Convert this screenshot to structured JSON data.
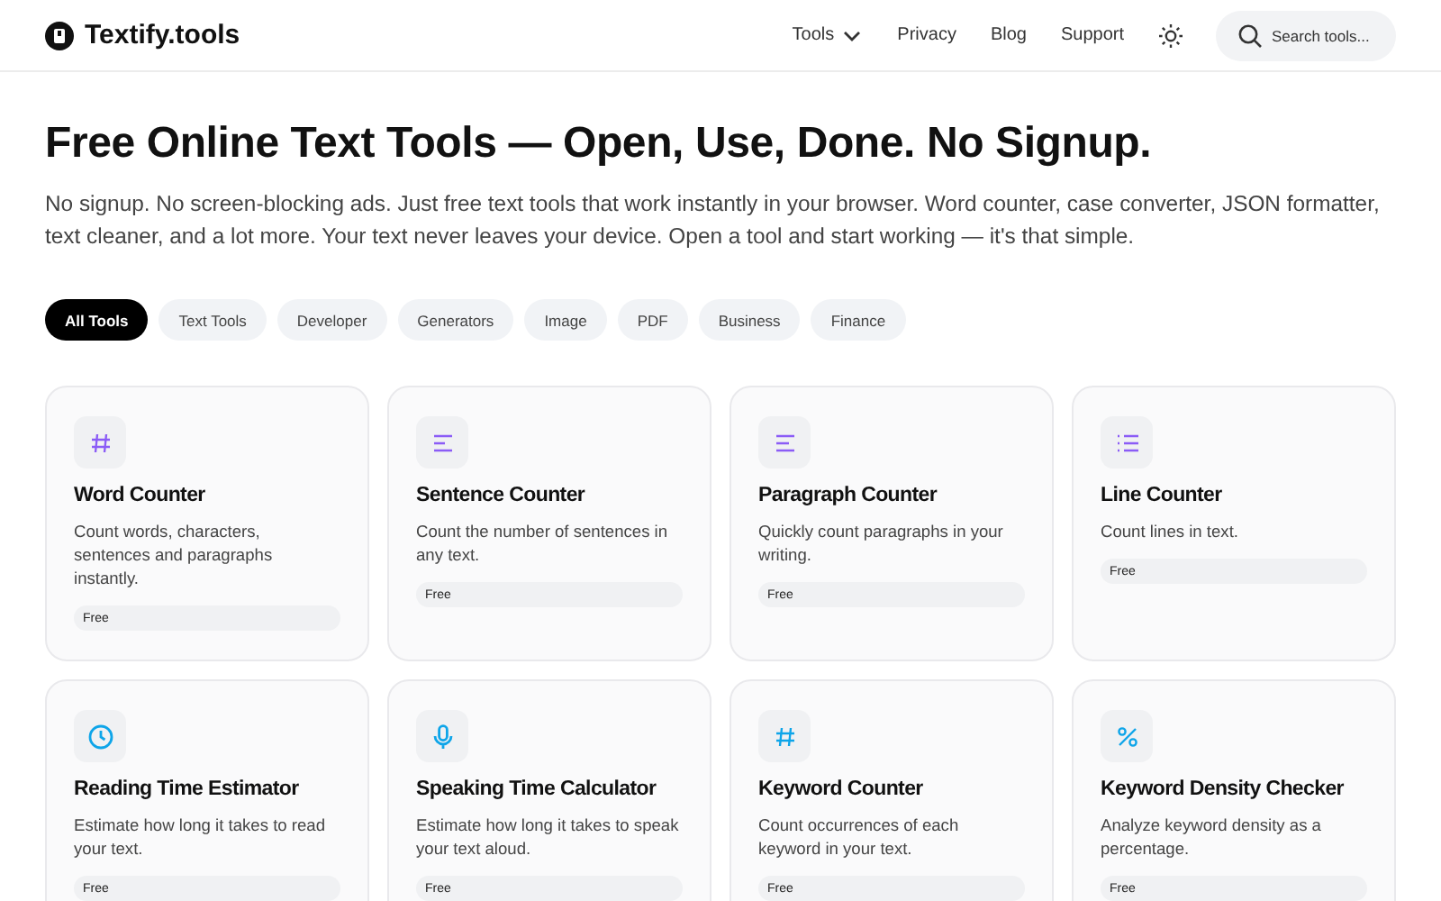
{
  "header": {
    "logo": "Textify.tools",
    "nav": [
      {
        "label": "Tools",
        "dropdown": true
      },
      {
        "label": "Privacy",
        "dropdown": false
      },
      {
        "label": "Blog",
        "dropdown": false
      },
      {
        "label": "Support",
        "dropdown": false
      }
    ],
    "search": {
      "placeholder": "Search tools..."
    }
  },
  "hero": {
    "title": "Free Online Text Tools — Open, Use, Done. No Signup.",
    "text": "No signup. No screen-blocking ads. Just free text tools that work instantly in your browser. Word counter, case converter, JSON formatter, text cleaner, and a lot more. Your text never leaves your device. Open a tool and start working — it's that simple."
  },
  "filters": [
    {
      "label": "All Tools",
      "selected": true
    },
    {
      "label": "Text Tools",
      "selected": false
    },
    {
      "label": "Developer",
      "selected": false
    },
    {
      "label": "Generators",
      "selected": false
    },
    {
      "label": "Image",
      "selected": false
    },
    {
      "label": "PDF",
      "selected": false
    },
    {
      "label": "Business",
      "selected": false
    },
    {
      "label": "Finance",
      "selected": false
    }
  ],
  "tools": [
    {
      "kind": "hash",
      "color": "#8b5cf6",
      "title": "Word Counter",
      "description": "Count words, characters, sentences and paragraphs instantly.",
      "badge": "Free"
    },
    {
      "kind": "short-lines",
      "color": "#8b5cf6",
      "title": "Sentence Counter",
      "description": "Count the number of sentences in any text.",
      "badge": "Free"
    },
    {
      "kind": "lines",
      "color": "#8b5cf6",
      "title": "Paragraph Counter",
      "description": "Quickly count paragraphs in your writing.",
      "badge": "Free"
    },
    {
      "kind": "list",
      "color": "#8b5cf6",
      "title": "Line Counter",
      "description": "Count lines in text.",
      "badge": "Free"
    },
    {
      "kind": "clock",
      "color": "#0ea5e9",
      "title": "Reading Time Estimator",
      "description": "Estimate how long it takes to read your text.",
      "badge": "Free"
    },
    {
      "kind": "mic",
      "color": "#0ea5e9",
      "title": "Speaking Time Calculator",
      "description": "Estimate how long it takes to speak your text aloud.",
      "badge": "Free"
    },
    {
      "kind": "hash",
      "color": "#0ea5e9",
      "title": "Keyword Counter",
      "description": "Count occurrences of each keyword in your text.",
      "badge": "Free"
    },
    {
      "kind": "percent",
      "color": "#0ea5e9",
      "title": "Keyword Density Checker",
      "description": "Analyze keyword density as a percentage.",
      "badge": "Free"
    }
  ]
}
